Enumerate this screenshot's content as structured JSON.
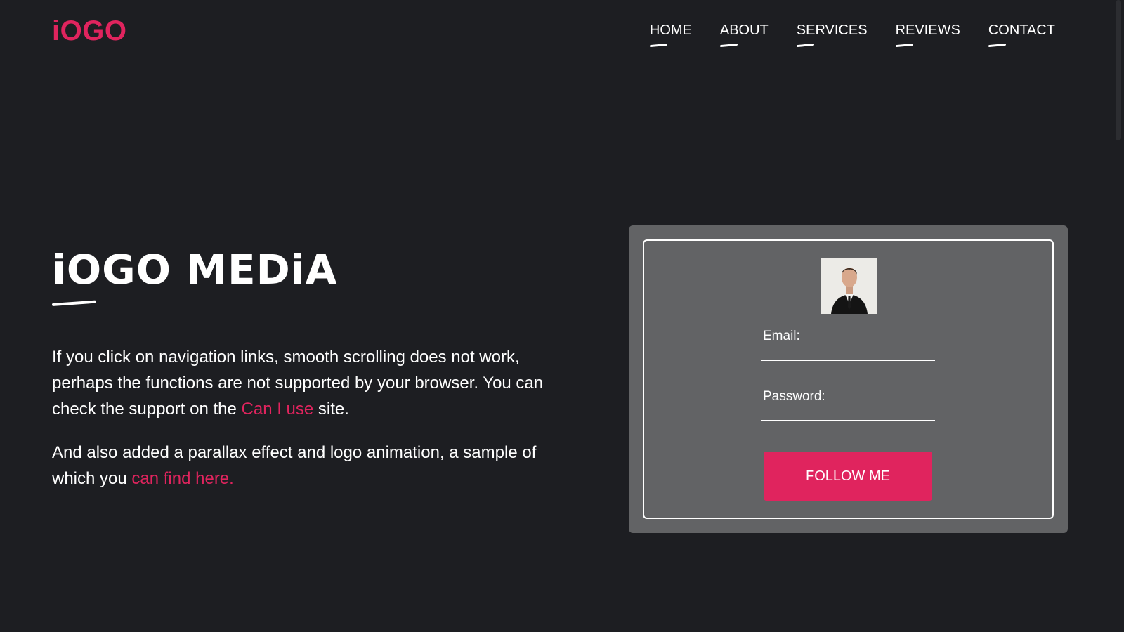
{
  "header": {
    "logo": "iOGO",
    "nav": [
      {
        "label": "HOME"
      },
      {
        "label": "ABOUT"
      },
      {
        "label": "SERVICES"
      },
      {
        "label": "REVIEWS"
      },
      {
        "label": "CONTACT"
      }
    ]
  },
  "hero": {
    "title": "iOGO MEDiA",
    "p1_before": "If you click on navigation links, smooth scrolling does not work, perhaps the functions are not supported by your browser. You can check the support on the ",
    "p1_link": "Can I use",
    "p1_after": " site.",
    "p2_before": "And also added a parallax effect and logo animation, a sample of which you ",
    "p2_link": "can find here."
  },
  "form": {
    "email_label": "Email:",
    "email_value": "",
    "password_label": "Password:",
    "password_value": "",
    "button": "FOLLOW ME"
  },
  "colors": {
    "background": "#1d1e22",
    "accent": "#e0245e",
    "card": "#626365",
    "text": "#ffffff"
  },
  "icons": {
    "avatar": "profile-photo"
  }
}
